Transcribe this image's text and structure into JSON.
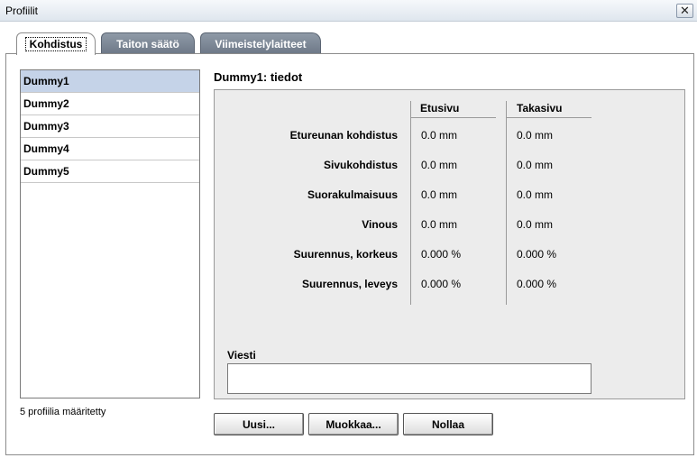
{
  "window": {
    "title": "Profiilit",
    "close_glyph": "✕"
  },
  "tabs": [
    {
      "label": "Kohdistus",
      "active": true
    },
    {
      "label": "Taiton säätö",
      "active": false
    },
    {
      "label": "Viimeistelylaitteet",
      "active": false
    }
  ],
  "profiles": {
    "items": [
      "Dummy1",
      "Dummy2",
      "Dummy3",
      "Dummy4",
      "Dummy5"
    ],
    "selected": "Dummy1",
    "count_text": "5 profiilia määritetty"
  },
  "details": {
    "heading": "Dummy1: tiedot",
    "columns": {
      "front": "Etusivu",
      "back": "Takasivu"
    },
    "rows": [
      {
        "label": "Etureunan kohdistus",
        "front": "0.0 mm",
        "back": "0.0 mm"
      },
      {
        "label": "Sivukohdistus",
        "front": "0.0 mm",
        "back": "0.0 mm"
      },
      {
        "label": "Suorakulmaisuus",
        "front": "0.0 mm",
        "back": "0.0 mm"
      },
      {
        "label": "Vinous",
        "front": "0.0 mm",
        "back": "0.0 mm"
      },
      {
        "label": "Suurennus, korkeus",
        "front": "0.000 %",
        "back": "0.000 %"
      },
      {
        "label": "Suurennus, leveys",
        "front": "0.000 %",
        "back": "0.000 %"
      }
    ],
    "message_label": "Viesti",
    "message_value": ""
  },
  "buttons": {
    "new": "Uusi...",
    "edit": "Muokkaa...",
    "reset": "Nollaa"
  },
  "colors": {
    "selection": "#c5d3e8",
    "panel": "#ececec",
    "tab_inactive": "#7b8695"
  }
}
